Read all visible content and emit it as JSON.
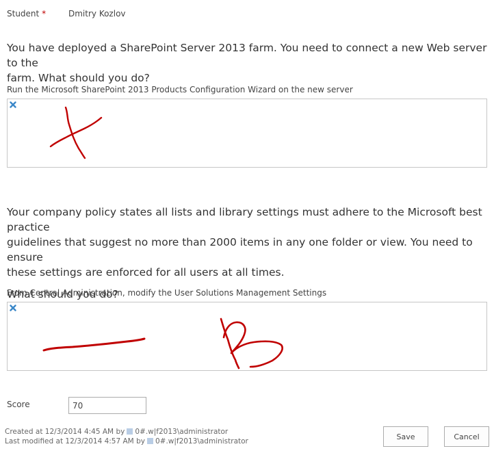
{
  "student": {
    "label": "Student",
    "required_mark": "*",
    "value": "Dmitry Kozlov"
  },
  "questions": [
    {
      "line1": "You have deployed a SharePoint Server 2013 farm. You need to connect a new Web server to the",
      "line2": "farm. What should you do?",
      "answer": "Run the Microsoft SharePoint 2013 Products Configuration Wizard on the new server",
      "delete_icon": "x-icon"
    },
    {
      "line1": "Your company policy states all lists and library settings must adhere to the Microsoft best practice",
      "line2": "guidelines that suggest no more than 2000 items in any one folder or view. You need to ensure",
      "line3": "these settings are enforced for all users at all times.",
      "line4": "What should you do?",
      "answer": "From Central Administration, modify the User Solutions Management Settings",
      "delete_icon": "x-icon"
    }
  ],
  "score": {
    "label": "Score",
    "value": "70"
  },
  "footer": {
    "created_prefix": "Created at 12/3/2014 4:45 AM by",
    "created_user": "0#.w|f2013\\administrator",
    "modified_prefix": "Last modified at 12/3/2014 4:57 AM by",
    "modified_user": "0#.w|f2013\\administrator"
  },
  "buttons": {
    "save": "Save",
    "cancel": "Cancel"
  },
  "colors": {
    "ink": "#c00000",
    "delete_icon": "#3a87c8",
    "required": "#bf0000"
  }
}
